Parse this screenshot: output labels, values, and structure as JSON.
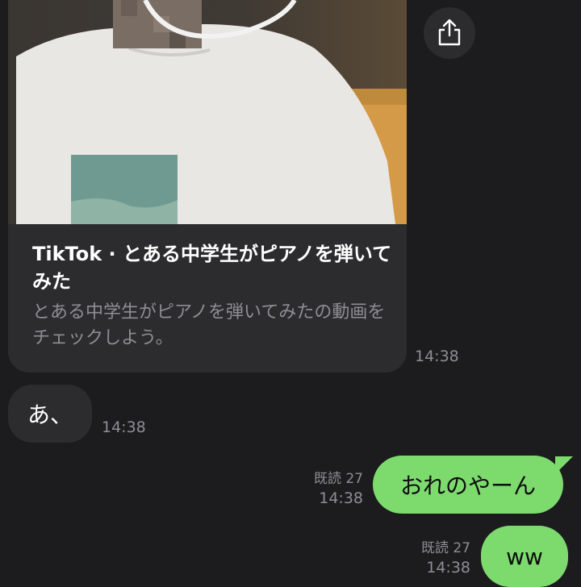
{
  "link_card": {
    "title": "TikTok · とある中学生がピアノを弾いてみた",
    "description": "とある中学生がピアノを弾いてみたの動画をチェックしよう。",
    "time": "14:38",
    "share_icon": "share-icon"
  },
  "messages": [
    {
      "side": "incoming",
      "text": "あ、",
      "time": "14:38"
    },
    {
      "side": "outgoing",
      "text": "おれのやーん",
      "read": "既読 27",
      "time": "14:38"
    },
    {
      "side": "outgoing",
      "text": "ww",
      "read": "既読 27",
      "time": "14:38"
    }
  ],
  "colors": {
    "background": "#1c1c1e",
    "incoming_bubble": "#2c2c2e",
    "outgoing_bubble": "#7ddb6e",
    "secondary_text": "#8e8e93"
  }
}
